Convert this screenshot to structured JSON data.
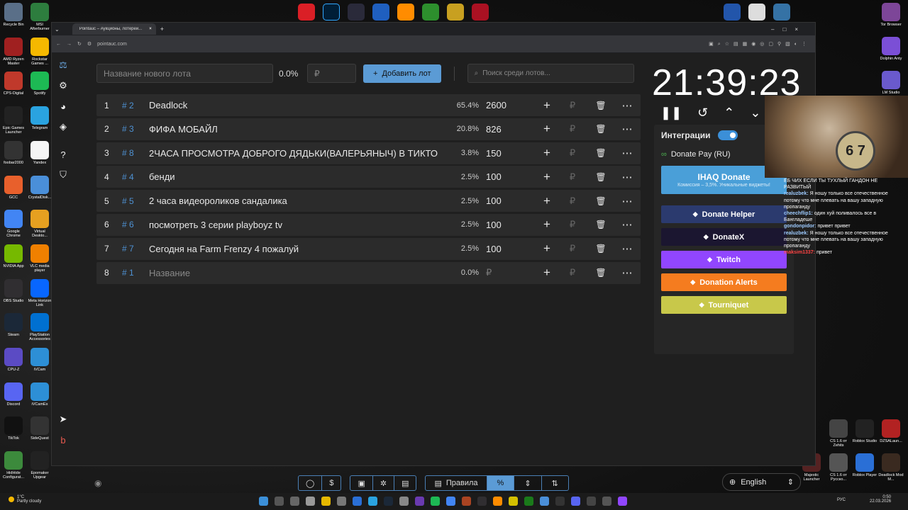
{
  "desktop_left": [
    {
      "label": "Recycle Bin",
      "color": "#5a6f88"
    },
    {
      "label": "MSI Afterburner",
      "color": "#2d7d3e"
    },
    {
      "label": "AMD Ryzen Master",
      "color": "#a02020"
    },
    {
      "label": "Rockstar Games ...",
      "color": "#f5b800"
    },
    {
      "label": "CPS-Digital",
      "color": "#c0392b"
    },
    {
      "label": "Spotify",
      "color": "#1db954"
    },
    {
      "label": "Epic Games Launcher",
      "color": "#222222"
    },
    {
      "label": "Telegram",
      "color": "#2aa3e0"
    },
    {
      "label": "foobar2000",
      "color": "#333333"
    },
    {
      "label": "Yandex",
      "color": "#f5f5f5"
    },
    {
      "label": "GCC",
      "color": "#e8602c"
    },
    {
      "label": "CrystalDisk...",
      "color": "#4a8fd9"
    },
    {
      "label": "Google Chrome",
      "color": "#4285f4"
    },
    {
      "label": "Virtual Deskto...",
      "color": "#e6a020"
    },
    {
      "label": "NVIDIA App",
      "color": "#76b900"
    },
    {
      "label": "VLC media player",
      "color": "#f08000"
    },
    {
      "label": "OBS Studio",
      "color": "#302e31"
    },
    {
      "label": "Meta Horizon Link",
      "color": "#0866ff"
    },
    {
      "label": "Steam",
      "color": "#1b2838"
    },
    {
      "label": "PlayStation Accessories",
      "color": "#0070d1"
    },
    {
      "label": "CPU-Z",
      "color": "#5b4bc4"
    },
    {
      "label": "iVCam",
      "color": "#2d8fd6"
    },
    {
      "label": "Discord",
      "color": "#5865f2"
    },
    {
      "label": "iVCamEx",
      "color": "#2d8fd6"
    },
    {
      "label": "TikTok",
      "color": "#111111"
    },
    {
      "label": "SideQuest",
      "color": "#333333"
    },
    {
      "label": "HidHide Configurat...",
      "color": "#3c8a3c"
    },
    {
      "label": "Epomaker Upgear",
      "color": "#222222"
    }
  ],
  "desktop_right": [
    {
      "label": "Tor Browser",
      "color": "#7d4698"
    },
    {
      "label": "Dolphin Anty",
      "color": "#7b4fd6"
    },
    {
      "label": "LM Studio",
      "color": "#6a5acd"
    },
    {
      "label": "CS 1.6 от Zehits",
      "color": "#444444"
    },
    {
      "label": "Roblox Studio",
      "color": "#222222"
    },
    {
      "label": "DZSALaun...",
      "color": "#b22222"
    },
    {
      "label": "Majestic Launcher",
      "color": "#552222"
    },
    {
      "label": "CS 1.6 от Русско...",
      "color": "#555555"
    },
    {
      "label": "Roblox Player",
      "color": "#2a6fd6"
    },
    {
      "label": "Deadlock Mod M...",
      "color": "#3a2a20"
    }
  ],
  "browser": {
    "tab_title": "Pointauc – Аукционы, лотереи...",
    "url": "pointauc.com"
  },
  "controls": {
    "lot_placeholder": "Название нового лота",
    "percent": "0.0%",
    "rub_placeholder": "₽",
    "add_button": "Добавить лот",
    "search_placeholder": "Поиск среди лотов..."
  },
  "lots": [
    {
      "num": "1",
      "id": "# 2",
      "name": "Deadlock",
      "pct": "65.4%",
      "amount": "2600"
    },
    {
      "num": "2",
      "id": "# 3",
      "name": "ФИФА МОБАЙЛ",
      "pct": "20.8%",
      "amount": "826"
    },
    {
      "num": "3",
      "id": "# 8",
      "name": "2ЧАСА ПРОСМОТРА ДОБРОГО ДЯДЬКИ(ВАЛЕРЬЯНЫЧ) В ТИКТО",
      "pct": "3.8%",
      "amount": "150"
    },
    {
      "num": "4",
      "id": "# 4",
      "name": "бенди",
      "pct": "2.5%",
      "amount": "100"
    },
    {
      "num": "5",
      "id": "# 5",
      "name": "2 часа видеороликов сандалика",
      "pct": "2.5%",
      "amount": "100"
    },
    {
      "num": "6",
      "id": "# 6",
      "name": "посмотреть 3 серии playboyz tv",
      "pct": "2.5%",
      "amount": "100"
    },
    {
      "num": "7",
      "id": "# 7",
      "name": "Сегодня на Farm Frenzy 4 пожалуй",
      "pct": "2.5%",
      "amount": "100"
    },
    {
      "num": "8",
      "id": "# 1",
      "name": "Название",
      "pct": "0.0%",
      "amount": "₽",
      "placeholder": true
    }
  ],
  "rub": "₽",
  "timer": "21:39:23",
  "integrations": {
    "title": "Интеграции",
    "donatepay": "Donate Pay (RU)",
    "services": [
      {
        "label": "IHAQ Donate",
        "sub": "Комиссия – 3,5%. Уникальные виджеты!",
        "color": "#4a9fd8"
      },
      {
        "label": "Donate Helper",
        "color": "#2b3a6e"
      },
      {
        "label": "DonateX",
        "color": "#1b1630"
      },
      {
        "label": "Twitch",
        "color": "#9146ff"
      },
      {
        "label": "Donation Alerts",
        "color": "#f57c1f"
      },
      {
        "label": "Tourniquet",
        "color": "#c8c84a"
      }
    ]
  },
  "chat": [
    {
      "user": "",
      "text": "ЕБ ЧИХ ЕСЛИ ТЫ ТУХЛЫЙ ГАНДОН НЕ РАЗВИТЫЙ"
    },
    {
      "user": "realuzbek:",
      "text": "Я ношу только все отечественное потому что мне плевать на вашу западную пропаганду"
    },
    {
      "user": "cheechflip1:",
      "text": "один хуй поливалось все в Бангладеше"
    },
    {
      "user": "gondonpidor:",
      "text": "привет привет"
    },
    {
      "user": "realuzbek:",
      "text": "Я ношу только все отечественное потому что мне плевать на вашу западную пропаганду"
    },
    {
      "user": "maksim1337:",
      "text": "привет",
      "red": true
    }
  ],
  "bottom": {
    "rules": "Правила",
    "percent_icon": "%",
    "language": "English"
  },
  "taskbar": {
    "weather_temp": "1°C",
    "weather_text": "Partly cloudy",
    "lang": "РУС",
    "time": "0:50",
    "date": "22.03.2026"
  }
}
